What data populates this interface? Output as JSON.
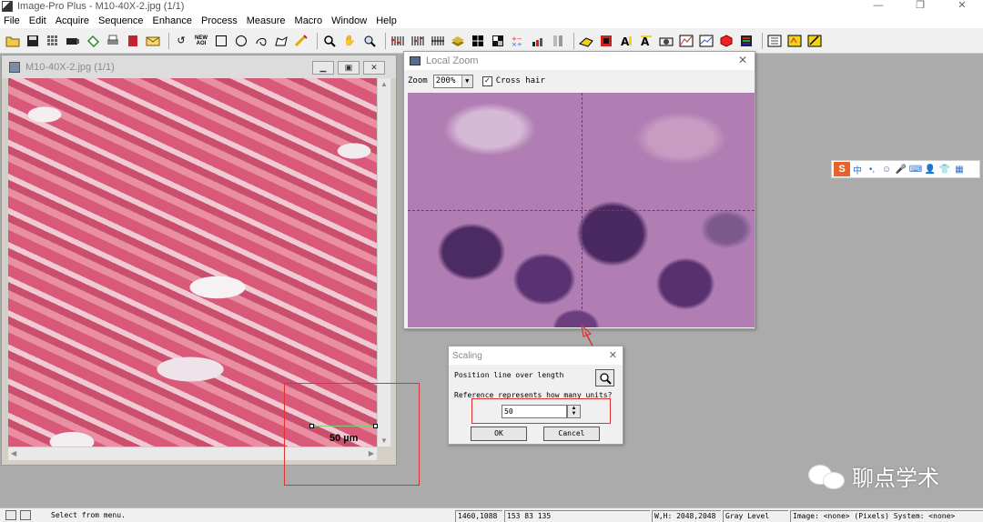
{
  "app": {
    "title": "Image-Pro Plus - M10-40X-2.jpg (1/1)",
    "window_buttons": [
      "—",
      "❐",
      "✕"
    ]
  },
  "menu": [
    "File",
    "Edit",
    "Acquire",
    "Sequence",
    "Enhance",
    "Process",
    "Measure",
    "Macro",
    "Window",
    "Help"
  ],
  "toolbar": {
    "icons": [
      "open-icon",
      "save-icon",
      "grid-icon",
      "camera-icon",
      "lasso-icon",
      "print-icon",
      "book-icon",
      "mail-icon",
      "new-aoi-icon",
      "rectangle-icon",
      "ellipse-icon",
      "freehand-icon",
      "irregular-icon",
      "wand-icon",
      "zoom-icon",
      "hand-icon",
      "zoom-box-icon",
      "filter-icon"
    ],
    "new_aoi_label": "NEW AOI"
  },
  "image_window": {
    "title": "M10-40X-2.jpg (1/1)",
    "scale_bar_label": "50 µm"
  },
  "local_zoom": {
    "title": "Local Zoom",
    "zoom_label": "Zoom",
    "zoom_value": "200%",
    "crosshair_label": "Cross hair",
    "crosshair_checked": true
  },
  "scaling": {
    "title": "Scaling",
    "position_label": "Position line over length",
    "reference_label": "Reference represents how many units?",
    "value": "50",
    "ok_label": "OK",
    "cancel_label": "Cancel"
  },
  "ime": {
    "items": [
      "S",
      "中",
      "•,",
      "☺",
      "🎤",
      "⌨",
      "👤",
      "👕",
      "▦"
    ]
  },
  "watermark": {
    "text": "聊点学术"
  },
  "status": {
    "message": "Select from menu.",
    "coords": "1460,1088",
    "rgb": "153  83 135",
    "wh": "W,H: 2048,2048",
    "mode": "Gray Level",
    "image_info": "Image: <none> (Pixels) System: <none>"
  },
  "colors": {
    "annotation_red": "#e03030",
    "scalebar_green": "#7fd06a"
  }
}
